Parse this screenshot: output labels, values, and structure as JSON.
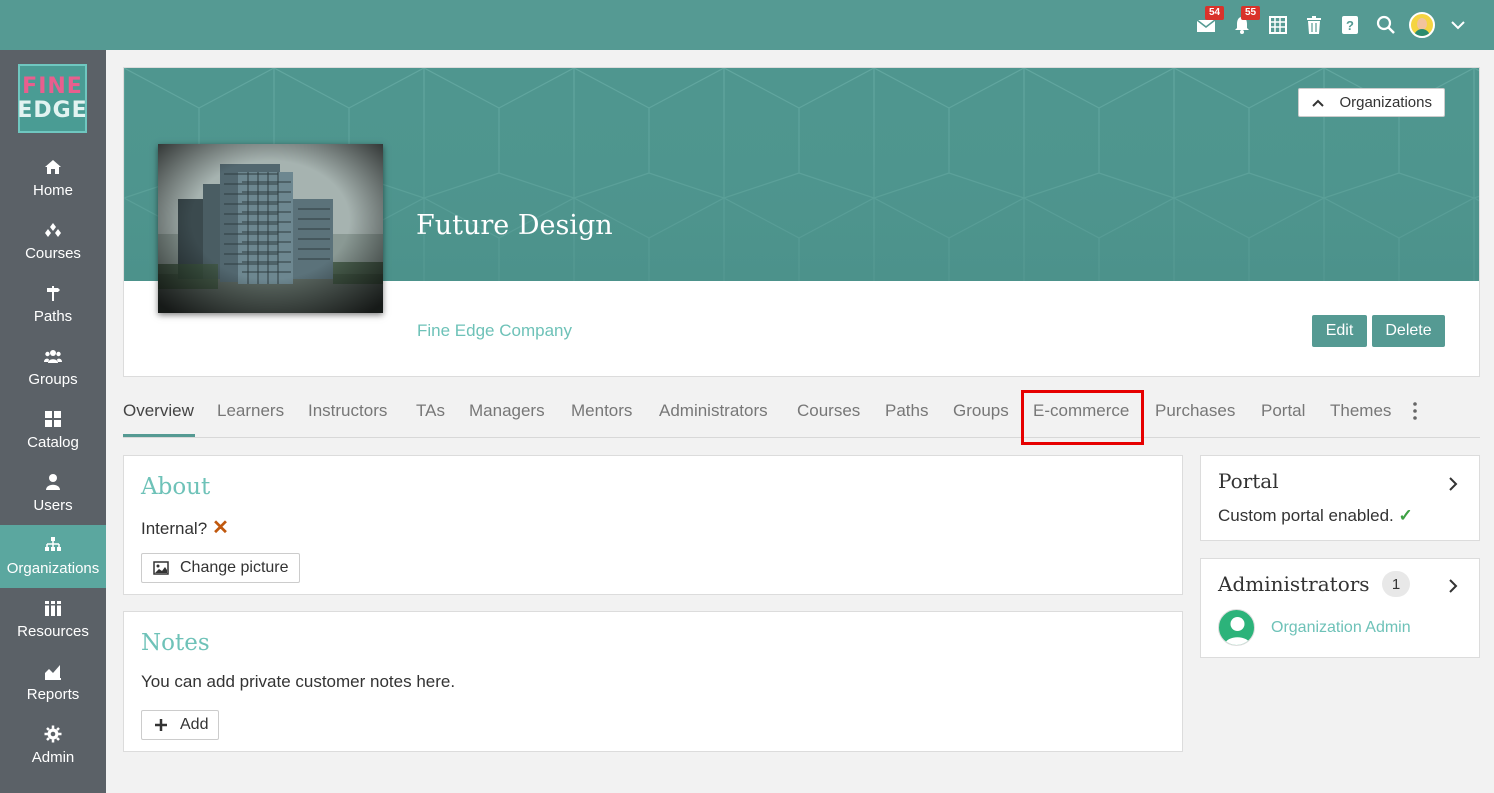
{
  "topbar": {
    "messages_badge": "54",
    "notifications_badge": "55"
  },
  "logo": {
    "line1": "FINE",
    "line2": "EDGE"
  },
  "sidebar": {
    "items": [
      {
        "label": "Home",
        "icon": "home-icon"
      },
      {
        "label": "Courses",
        "icon": "courses-icon"
      },
      {
        "label": "Paths",
        "icon": "paths-icon"
      },
      {
        "label": "Groups",
        "icon": "groups-icon"
      },
      {
        "label": "Catalog",
        "icon": "catalog-icon"
      },
      {
        "label": "Users",
        "icon": "users-icon"
      },
      {
        "label": "Organizations",
        "icon": "organizations-icon",
        "active": true
      },
      {
        "label": "Resources",
        "icon": "resources-icon"
      },
      {
        "label": "Reports",
        "icon": "reports-icon"
      },
      {
        "label": "Admin",
        "icon": "admin-icon"
      }
    ]
  },
  "header": {
    "organizations_button": "Organizations",
    "title": "Future Design",
    "subtitle": "Fine Edge Company",
    "edit_label": "Edit",
    "delete_label": "Delete"
  },
  "tabs": [
    "Overview",
    "Learners",
    "Instructors",
    "TAs",
    "Managers",
    "Mentors",
    "Administrators",
    "Courses",
    "Paths",
    "Groups",
    "E-commerce",
    "Purchases",
    "Portal",
    "Themes"
  ],
  "about": {
    "title": "About",
    "internal_label": "Internal?",
    "internal_mark": "✕",
    "change_picture": "Change picture"
  },
  "notes": {
    "title": "Notes",
    "text": "You can add private customer notes here.",
    "add_label": "Add"
  },
  "portal": {
    "title": "Portal",
    "status": "Custom portal enabled.",
    "status_mark": "✓"
  },
  "administrators": {
    "title": "Administrators",
    "count": "1",
    "user": "Organization Admin"
  },
  "colors": {
    "brand": "#559a93",
    "sidebar": "#5b6167",
    "accent_text": "#6ec2b8",
    "highlight": "#e60000"
  }
}
